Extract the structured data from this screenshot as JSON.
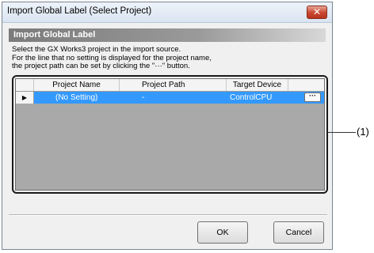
{
  "window": {
    "title": "Import Global Label (Select Project)",
    "close_symbol": "✕"
  },
  "section": {
    "header": "Import Global Label"
  },
  "description": {
    "line1": "Select the GX Works3 project in the import source.",
    "line2": "For the line that no setting is displayed for the project name,",
    "line3": "the project path can be set by clicking the \"···\" button."
  },
  "grid": {
    "columns": [
      "Project Name",
      "Project Path",
      "Target Device"
    ],
    "rows": [
      {
        "indicator": "▶",
        "project_name": "(No Setting)",
        "project_path": "-",
        "target_device": "ControlCPU",
        "browse_label": "···",
        "selected": true
      }
    ]
  },
  "buttons": {
    "ok": "OK",
    "cancel": "Cancel"
  },
  "callout": {
    "label": "(1)"
  },
  "colors": {
    "selection": "#3399ff",
    "grid_empty_area": "#a9a9a9",
    "close_button": "#c9452f"
  }
}
